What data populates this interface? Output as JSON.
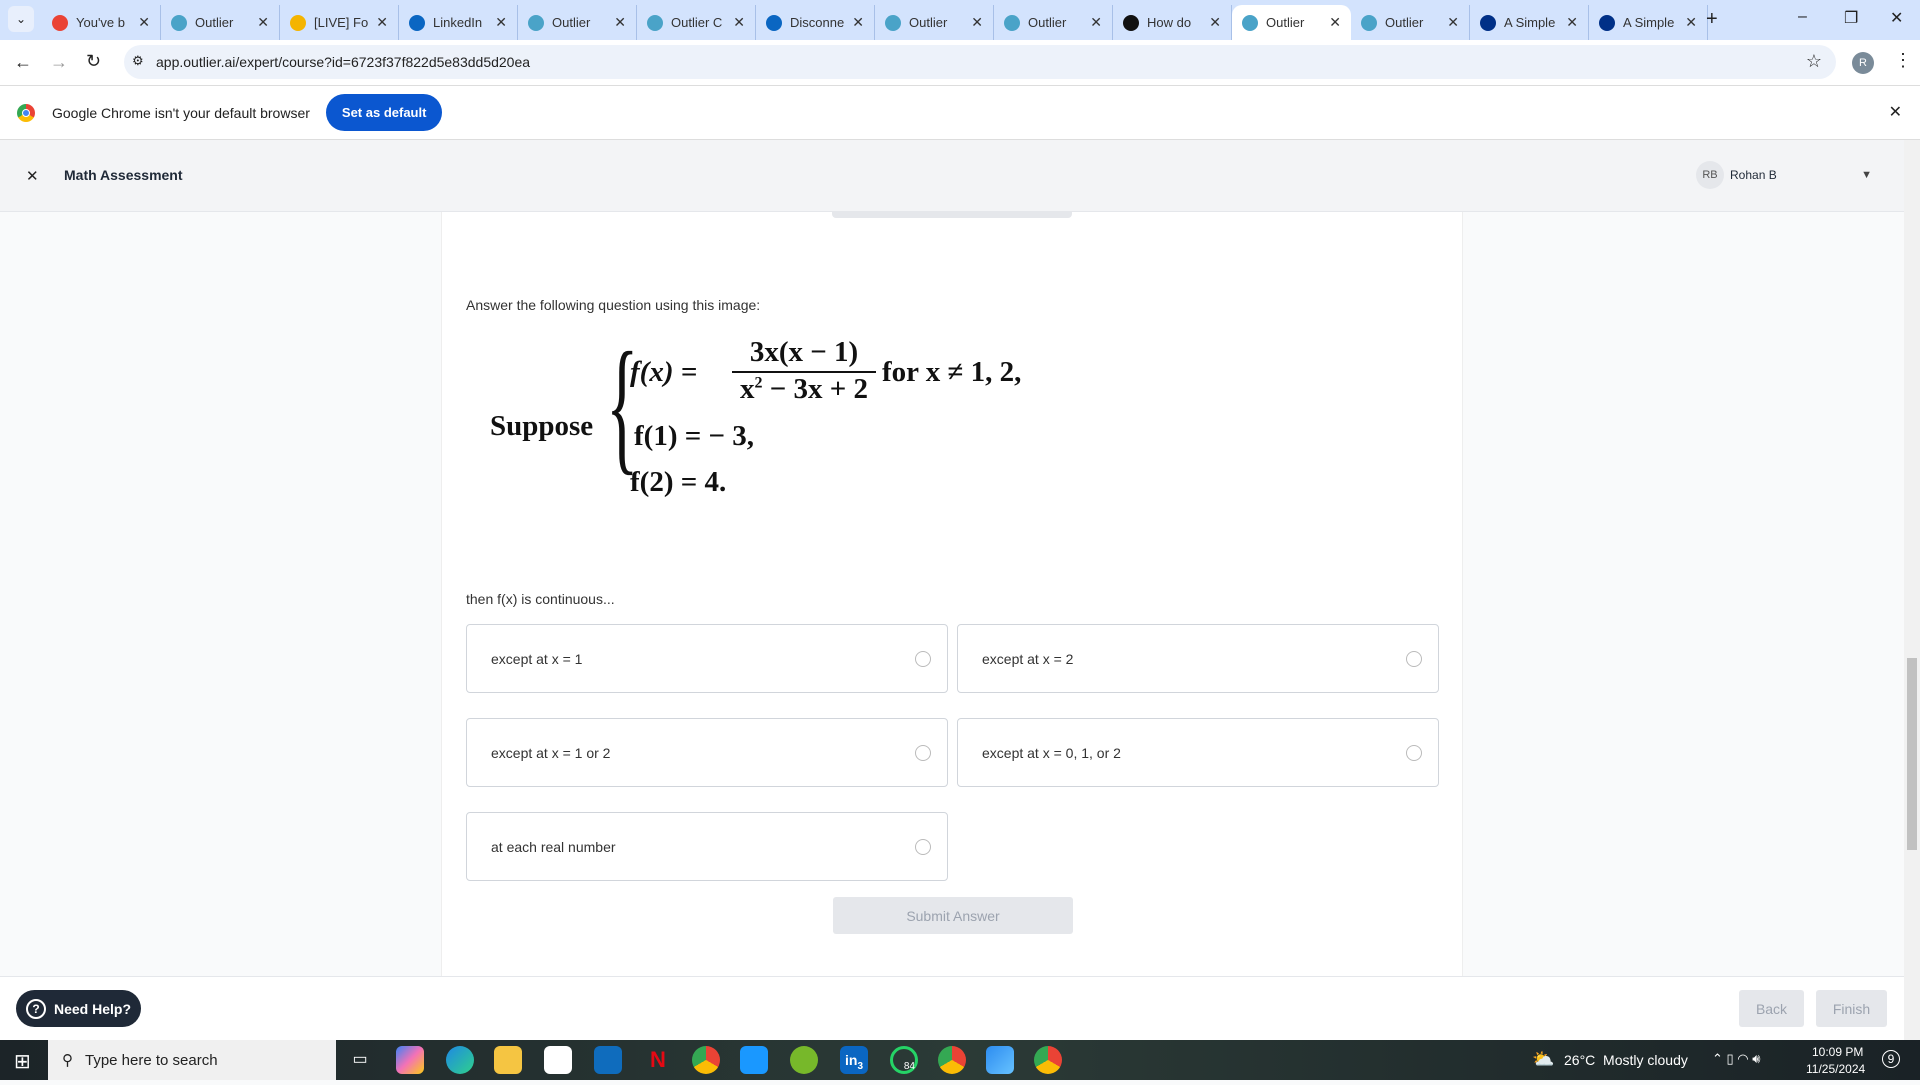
{
  "browser": {
    "tabs": [
      {
        "title": "You've b",
        "color": "#ea4335"
      },
      {
        "title": "Outlier",
        "color": "#4aa3c8"
      },
      {
        "title": "[LIVE] Fo",
        "color": "#f4b400"
      },
      {
        "title": "LinkedIn",
        "color": "#0a66c2"
      },
      {
        "title": "Outlier",
        "color": "#4aa3c8"
      },
      {
        "title": "Outlier C",
        "color": "#4aa3c8"
      },
      {
        "title": "Disconne",
        "color": "#0a66c2"
      },
      {
        "title": "Outlier",
        "color": "#4aa3c8"
      },
      {
        "title": "Outlier",
        "color": "#4aa3c8"
      },
      {
        "title": "How do",
        "color": "#111111"
      },
      {
        "title": "Outlier",
        "color": "#4aa3c8",
        "active": true
      },
      {
        "title": "Outlier",
        "color": "#4aa3c8"
      },
      {
        "title": "A Simple",
        "color": "#003087"
      },
      {
        "title": "A Simple",
        "color": "#003087"
      }
    ],
    "url": "app.outlier.ai/expert/course?id=6723f37f822d5e83dd5d20ea",
    "profile_initial": "R",
    "infobar": {
      "message": "Google Chrome isn't your default browser",
      "button": "Set as default"
    }
  },
  "header": {
    "title": "Math Assessment",
    "user_initials": "RB",
    "user_name": "Rohan B"
  },
  "question": {
    "prompt": "Answer the following question using this image:",
    "image": {
      "suppose": "Suppose",
      "numerator": "3x(x − 1)",
      "denominator_a": "x",
      "denominator_exp": "2",
      "denominator_b": " − 3x + 2",
      "lhs1": "f(x) =",
      "cond": "for x ≠ 1,  2,",
      "line2": "f(1) = − 3,",
      "line3": "f(2) = 4."
    },
    "stem": "then f(x) is continuous...",
    "options": [
      "except at x = 1",
      "except at x = 2",
      "except at x = 1 or 2",
      "except at x = 0, 1, or 2",
      "at each real number"
    ],
    "submit": "Submit Answer"
  },
  "footer": {
    "help": "Need Help?",
    "back": "Back",
    "finish": "Finish"
  },
  "taskbar": {
    "search_placeholder": "Type here to search",
    "weather": "26°C  Mostly cloudy",
    "time": "10:09 PM",
    "date": "11/25/2024",
    "notifications": "9",
    "badges": {
      "linkedin": "3",
      "whatsapp": "84"
    }
  }
}
